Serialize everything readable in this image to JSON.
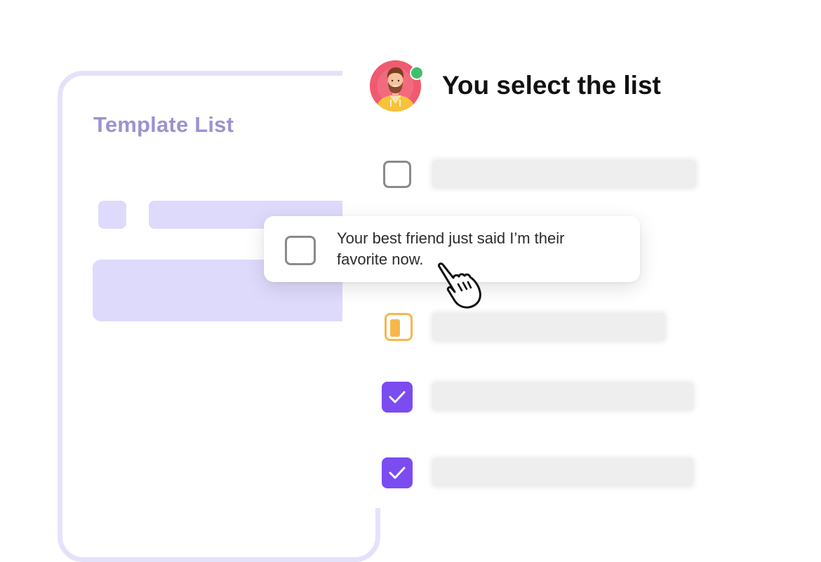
{
  "template_panel": {
    "title": "Template List"
  },
  "main_panel": {
    "heading": "You select the list",
    "online_status_color": "#3fbf68"
  },
  "popup": {
    "text": "Your best friend just said I’m their favorite now.",
    "checkbox_state": "unchecked"
  },
  "task_rows": [
    {
      "checkbox_state": "unchecked"
    },
    {
      "checkbox_state": "partial",
      "color": "#f6b84b"
    },
    {
      "checkbox_state": "checked",
      "color": "#7b4cf0"
    },
    {
      "checkbox_state": "checked",
      "color": "#7b4cf0"
    }
  ],
  "icons": {
    "avatar": "user-avatar",
    "cursor": "hand-pointer-icon",
    "check": "checkmark-icon"
  },
  "colors": {
    "accent_purple": "#7b4cf0",
    "template_lavender": "#dedafc",
    "template_title": "#9d92cf",
    "partial_orange": "#f6b84b"
  }
}
